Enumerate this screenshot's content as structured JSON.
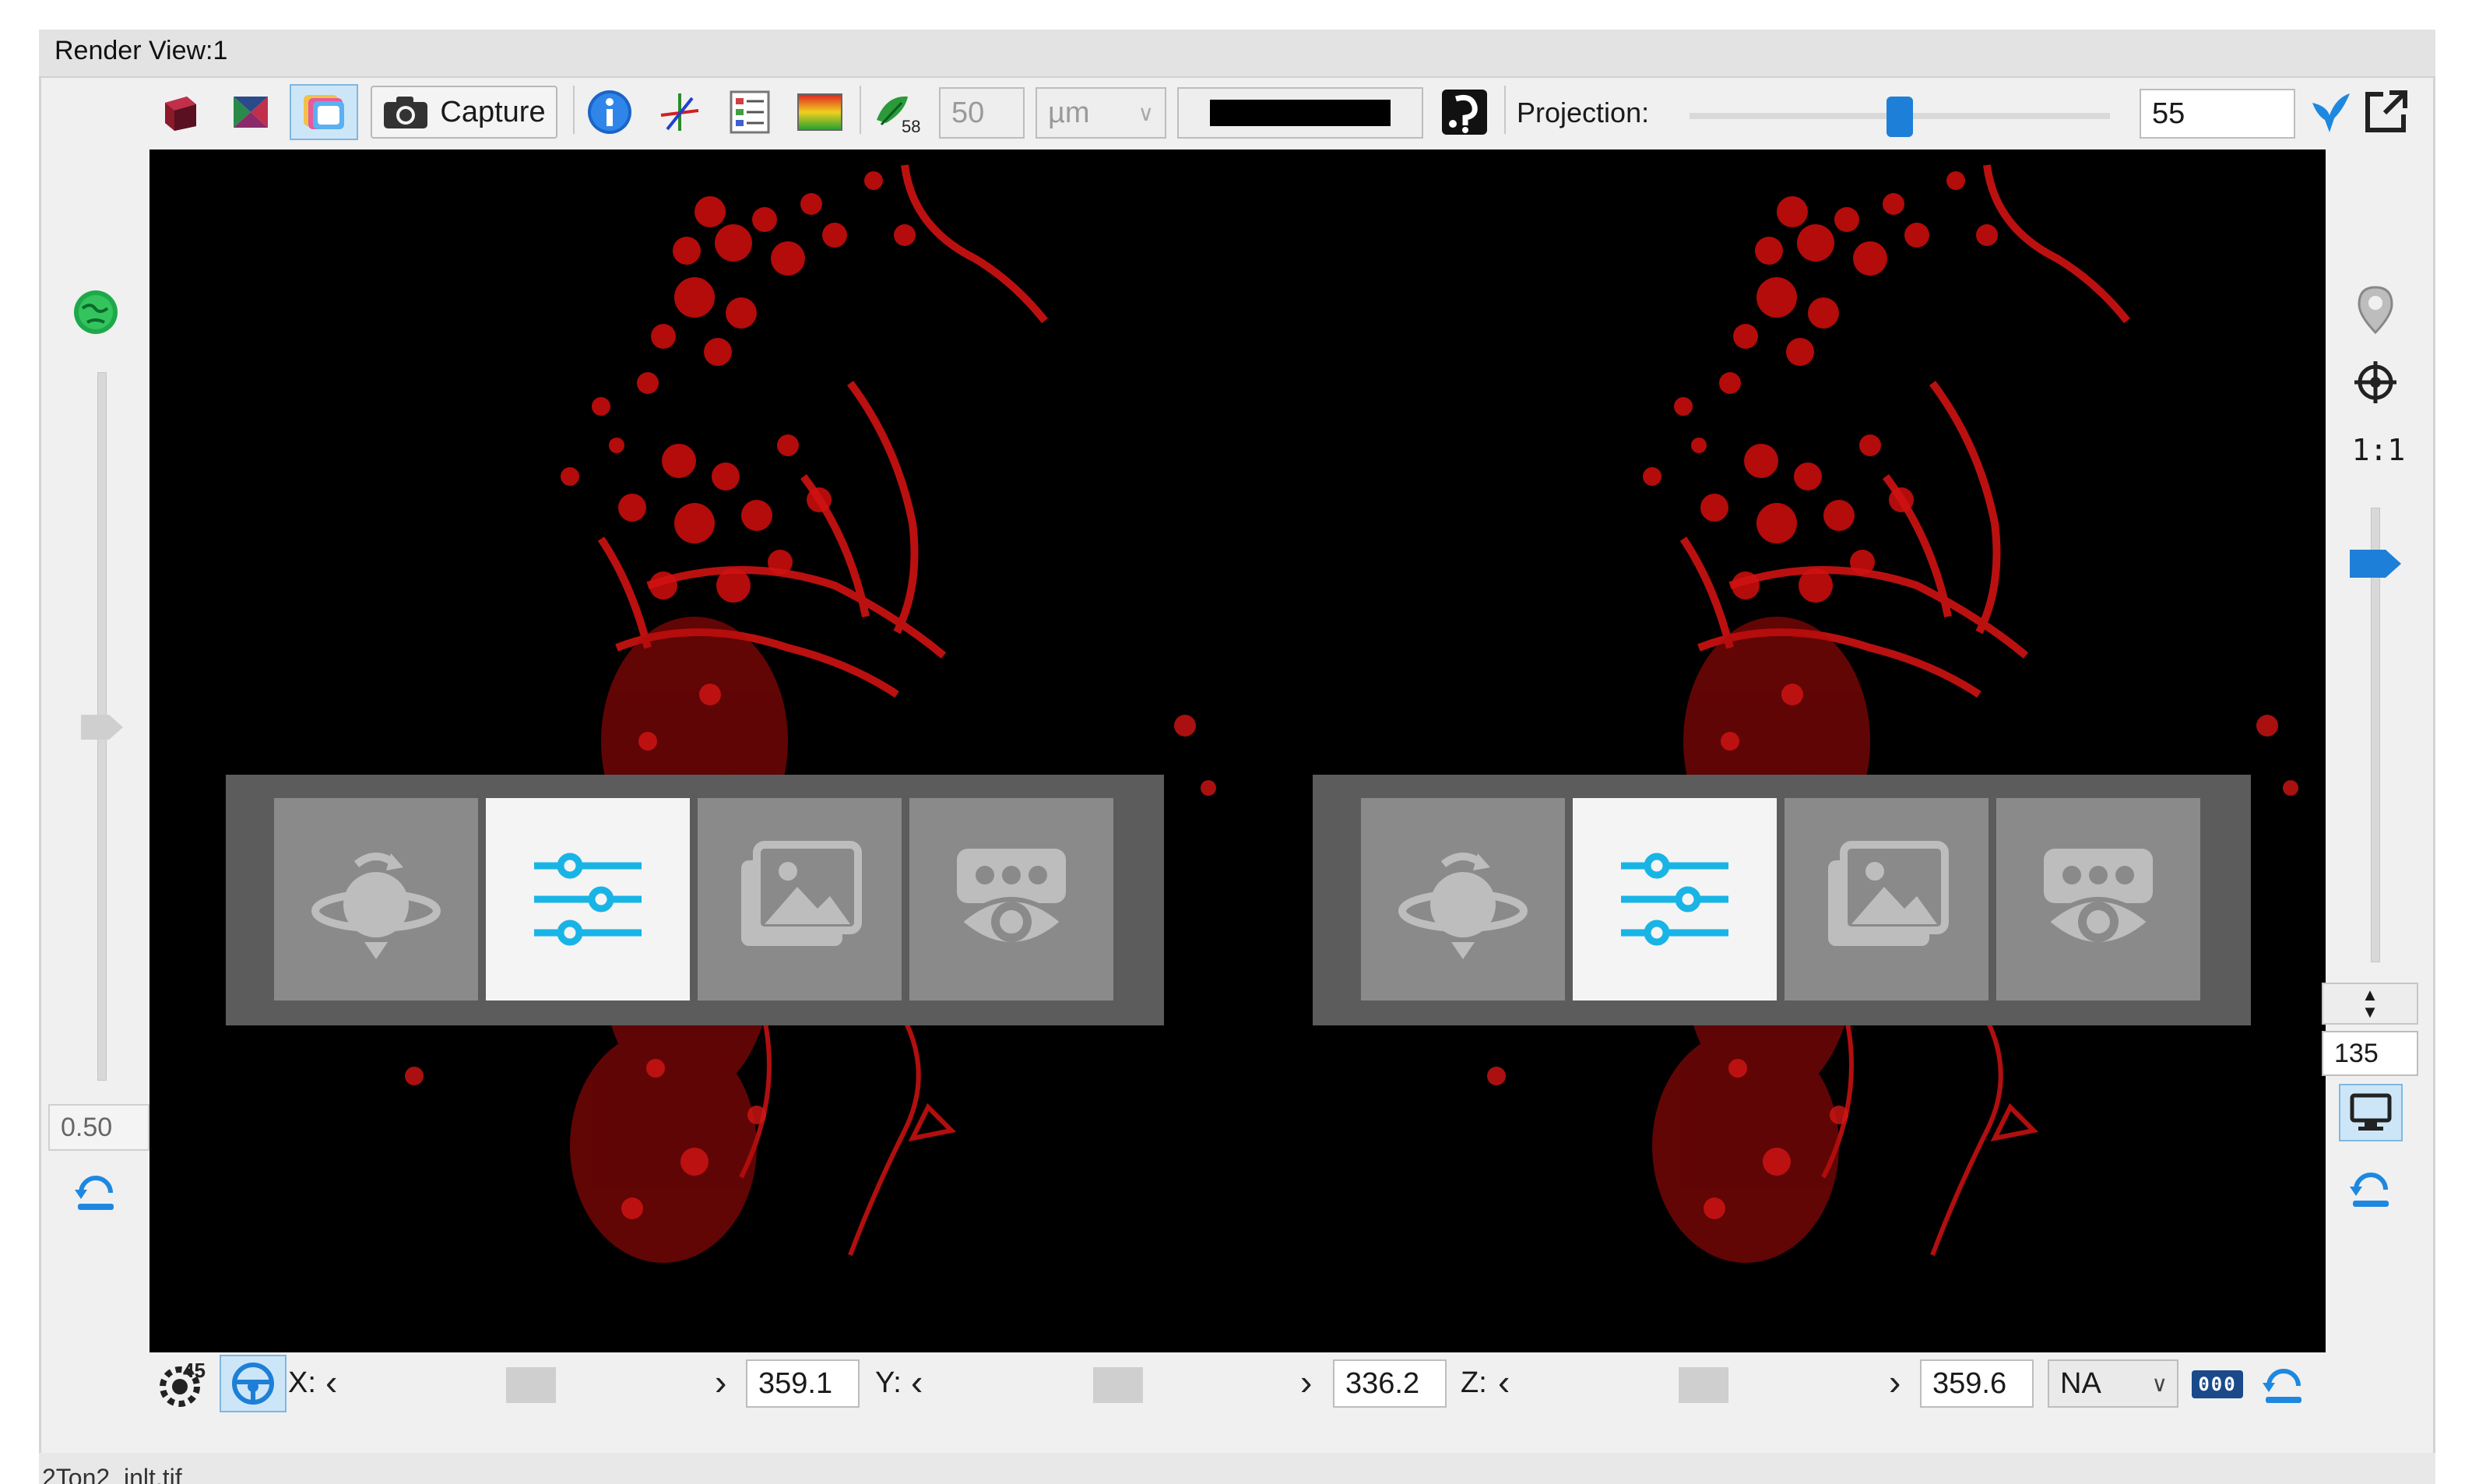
{
  "window": {
    "title": "Render View:1",
    "status_text": "2Ton2_inlt.tif"
  },
  "toolbar": {
    "capture_label": "Capture",
    "scale_value": "50",
    "scale_unit": "µm",
    "background_color": "#000000",
    "projection_label": "Projection:",
    "projection_value": "55",
    "projection_level": 0.5
  },
  "left_panel": {
    "value": "0.50"
  },
  "right_panel": {
    "zoom_label": "1:1",
    "value": "135"
  },
  "overlay_buttons": [
    "rotate",
    "settings-sliders",
    "image",
    "camera-eye"
  ],
  "bottom_bar": {
    "x_label": "X:",
    "x_value": "359.1",
    "y_label": "Y:",
    "y_value": "336.2",
    "z_label": "Z:",
    "z_value": "359.6",
    "mode": "NA",
    "counter_icon_text": "000",
    "angle_text": "45"
  },
  "colors": {
    "accent": "#1e7fd8",
    "cyan": "#19b4e6",
    "signal": "#d01010"
  }
}
